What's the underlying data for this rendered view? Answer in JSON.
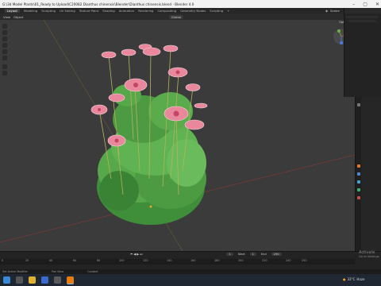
{
  "window": {
    "title": "G:\\3d Model Plants\\01_Ready to Upload\\C20082 Dianthus chinensis\\Blender\\Dianthus chinensis.blend - Blender 4.0"
  },
  "topbar": {
    "scene_label": "Scene"
  },
  "workspaces": {
    "tabs": [
      "Layout",
      "Modeling",
      "Sculpting",
      "UV Editing",
      "Texture Paint",
      "Shading",
      "Animation",
      "Rendering",
      "Compositing",
      "Geometry Nodes",
      "Scripting"
    ],
    "active": "Layout",
    "add": "+"
  },
  "viewport_header": {
    "view_menu": "View",
    "object_menu": "Object",
    "transform": "Global",
    "options": "Options"
  },
  "timeline": {
    "playback_items": [
      "Playback",
      "Keying",
      "View",
      "Marker"
    ],
    "frame_current": "1",
    "start_label": "Start",
    "start_value": "1",
    "end_label": "End",
    "end_value": "250",
    "ruler": [
      "0",
      "20",
      "40",
      "60",
      "80",
      "100",
      "120",
      "140",
      "160",
      "180",
      "200",
      "220",
      "240",
      "250"
    ]
  },
  "status": {
    "left": "Set Active Modifier",
    "pan": "Pan View",
    "context": "Context"
  },
  "activation": {
    "line1": "Activate",
    "line2": "Go to Settings"
  },
  "taskbar": {
    "weather": "33°C",
    "weather_text": "Haze",
    "colors": {
      "bar": "#1f2733",
      "blender": "#e87d0d",
      "start": "#3b88d6"
    }
  }
}
